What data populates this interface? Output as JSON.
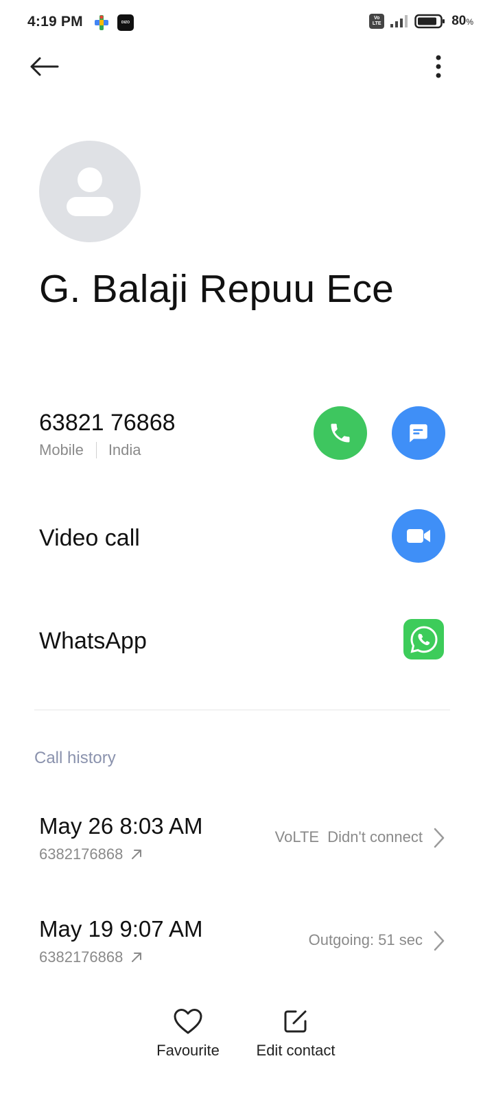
{
  "status_bar": {
    "time": "4:19 PM",
    "app_badge": "DIZO",
    "network_badge_top": "Vo",
    "network_badge_bottom": "LTE",
    "battery_percent": "80",
    "battery_suffix": "%"
  },
  "contact": {
    "name": "G. Balaji Repuu Ece",
    "phone": "63821 76868",
    "phone_type": "Mobile",
    "phone_country": "India"
  },
  "actions": {
    "video_call_label": "Video call",
    "whatsapp_label": "WhatsApp"
  },
  "call_history": {
    "title": "Call history",
    "entries": [
      {
        "date": "May 26 8:03 AM",
        "number": "6382176868",
        "status": "VoLTE  Didn't connect"
      },
      {
        "date": "May 19 9:07 AM",
        "number": "6382176868",
        "status": "Outgoing: 51 sec"
      }
    ]
  },
  "bottom_bar": {
    "favourite_label": "Favourite",
    "edit_label": "Edit contact"
  },
  "colors": {
    "call_green": "#3ec65f",
    "action_blue": "#3f8ff7",
    "whatsapp_green": "#3dcc5a",
    "section_title": "#8a92ad"
  }
}
